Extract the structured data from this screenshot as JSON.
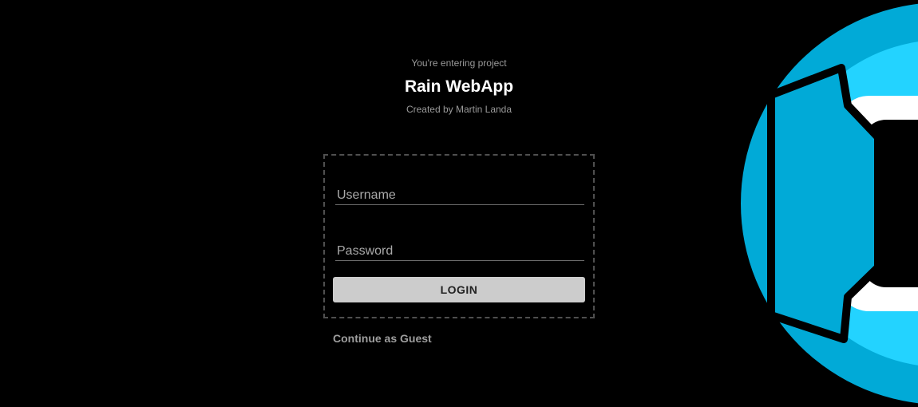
{
  "header": {
    "kicker": "You're entering project",
    "title": "Rain WebApp",
    "author": "Created by Martin Landa"
  },
  "login_form": {
    "username_placeholder": "Username",
    "username_value": "",
    "password_placeholder": "Password",
    "password_value": "",
    "login_label": "LOGIN"
  },
  "guest_link": "Continue as Guest",
  "logo": {
    "icon": "rain-logo-icon",
    "colors": {
      "outer_ring": "#01aad7",
      "inner_ring": "#23d3ff",
      "core": "#ffffff",
      "outline": "#000000"
    }
  }
}
